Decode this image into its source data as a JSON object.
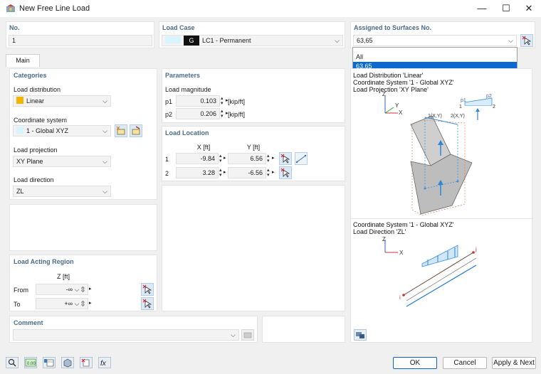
{
  "window": {
    "title": "New Free Line Load",
    "min": "—",
    "max": "☐",
    "close": "✕"
  },
  "no": {
    "header": "No.",
    "value": "1"
  },
  "load_case": {
    "header": "Load Case",
    "code": "G",
    "value": "LC1 - Permanent",
    "color": "#ffffff"
  },
  "assigned": {
    "header": "Assigned to Surfaces No.",
    "value": "63,65",
    "options": [
      "All",
      "63,65"
    ],
    "selected": "63,65"
  },
  "tabs": [
    "Main"
  ],
  "categories": {
    "header": "Categories",
    "load_distribution_label": "Load distribution",
    "load_distribution_value": "Linear",
    "load_distribution_color": "#f5b400",
    "coordinate_system_label": "Coordinate system",
    "coordinate_system_value": "1 - Global XYZ",
    "load_projection_label": "Load projection",
    "load_projection_value": "XY Plane",
    "load_direction_label": "Load direction",
    "load_direction_value": "ZL"
  },
  "parameters": {
    "header": "Parameters",
    "magnitude_label": "Load magnitude",
    "p1_label": "p1",
    "p1_value": "0.103",
    "p1_unit": "[kip/ft]",
    "p2_label": "p2",
    "p2_value": "0.206",
    "p2_unit": "[kip/ft]"
  },
  "location": {
    "header": "Load Location",
    "x_header": "X [ft]",
    "y_header": "Y [ft]",
    "rows": [
      {
        "id": "1",
        "x": "-9.84",
        "y": "6.56"
      },
      {
        "id": "2",
        "x": "3.28",
        "y": "-6.56"
      }
    ]
  },
  "region": {
    "header": "Load Acting Region",
    "z_header": "Z [ft]",
    "from_label": "From",
    "from_value": "-∞",
    "to_label": "To",
    "to_value": "+∞"
  },
  "comment": {
    "header": "Comment",
    "value": ""
  },
  "diagram1": {
    "lines": [
      "Load Distribution 'Linear'",
      "Coordinate System '1 - Global XYZ'",
      "Load Projection 'XY Plane'"
    ],
    "axis_z": "Z",
    "axis_y": "Y",
    "axis_x": "X",
    "p1": "p1",
    "p2": "p2",
    "n1": "1",
    "n2": "2",
    "pt1": "1(X,Y)",
    "pt2": "2(X,Y)"
  },
  "diagram2": {
    "lines": [
      "Coordinate System '1 - Global XYZ'",
      "Load Direction 'ZL'"
    ],
    "axis_z": "Z",
    "axis_x": "X",
    "i": "i",
    "j": "j"
  },
  "footer": {
    "ok": "OK",
    "cancel": "Cancel",
    "apply_next": "Apply & Next"
  }
}
